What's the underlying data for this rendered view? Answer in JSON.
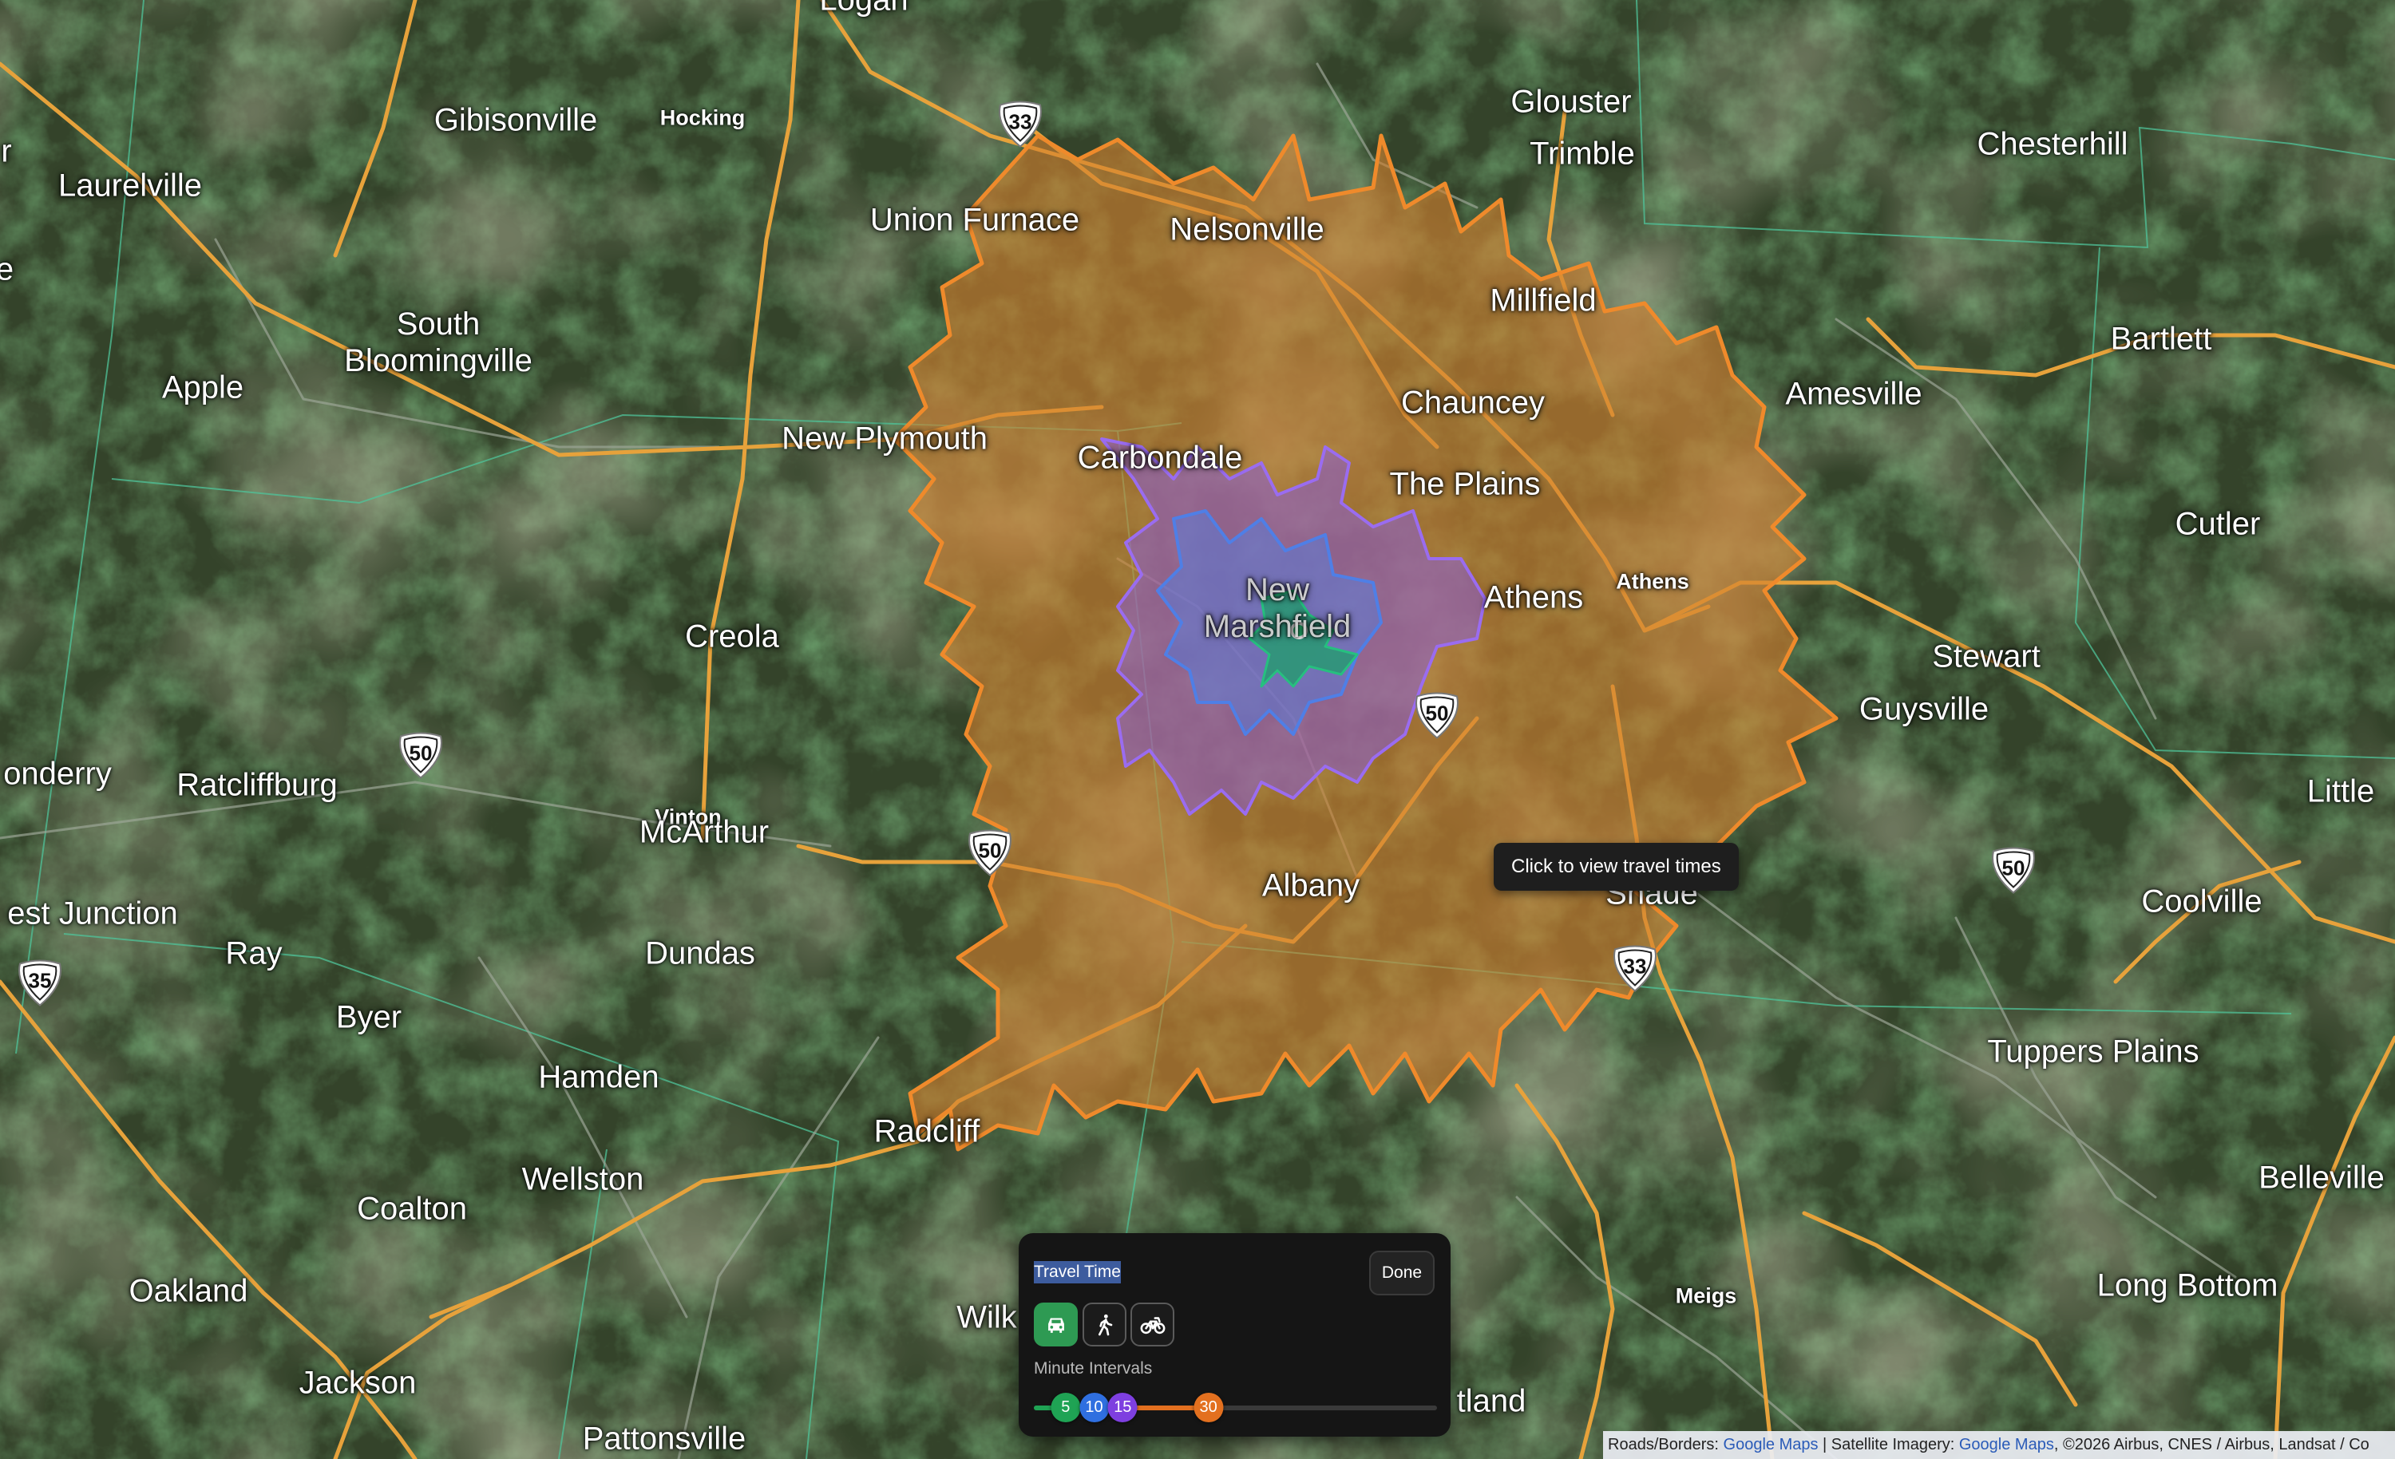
{
  "map": {
    "places": [
      {
        "id": "logan",
        "text": "Logan",
        "size": "big"
      },
      {
        "id": "gibisonville",
        "text": "Gibisonville",
        "size": "big"
      },
      {
        "id": "hocking",
        "text": "Hocking",
        "size": "small"
      },
      {
        "id": "laurelville",
        "text": "Laurelville",
        "size": "big"
      },
      {
        "id": "union-furnace",
        "text": "Union Furnace",
        "size": "big"
      },
      {
        "id": "nelsonville",
        "text": "Nelsonville",
        "size": "big"
      },
      {
        "id": "glouster",
        "text": "Glouster",
        "size": "big"
      },
      {
        "id": "trimble",
        "text": "Trimble",
        "size": "big"
      },
      {
        "id": "chesterhill",
        "text": "Chesterhill",
        "size": "big"
      },
      {
        "id": "millfield",
        "text": "Millfield",
        "size": "big"
      },
      {
        "id": "bartlett",
        "text": "Bartlett",
        "size": "big"
      },
      {
        "id": "apple",
        "text": "Apple",
        "size": "big"
      },
      {
        "id": "chauncey",
        "text": "Chauncey",
        "size": "big"
      },
      {
        "id": "amesville",
        "text": "Amesville",
        "size": "big"
      },
      {
        "id": "new-plymouth",
        "text": "New Plymouth",
        "size": "big"
      },
      {
        "id": "carbondale",
        "text": "Carbondale",
        "size": "big"
      },
      {
        "id": "the-plains",
        "text": "The Plains",
        "size": "big"
      },
      {
        "id": "cutler",
        "text": "Cutler",
        "size": "big"
      },
      {
        "id": "athens-county",
        "text": "Athens",
        "size": "small"
      },
      {
        "id": "athens",
        "text": "Athens",
        "size": "big"
      },
      {
        "id": "creola",
        "text": "Creola",
        "size": "big"
      },
      {
        "id": "stewart",
        "text": "Stewart",
        "size": "big"
      },
      {
        "id": "guysville",
        "text": "Guysville",
        "size": "big"
      },
      {
        "id": "londonderry",
        "text": "onderry",
        "size": "big"
      },
      {
        "id": "ratcliffburg",
        "text": "Ratcliffburg",
        "size": "big"
      },
      {
        "id": "vinton",
        "text": "Vinton",
        "size": "small"
      },
      {
        "id": "mcarthur",
        "text": "McArthur",
        "size": "big"
      },
      {
        "id": "little",
        "text": "Little",
        "size": "big"
      },
      {
        "id": "albany",
        "text": "Albany",
        "size": "big"
      },
      {
        "id": "coolville",
        "text": "Coolville",
        "size": "big"
      },
      {
        "id": "west-junction",
        "text": "est Junction",
        "size": "big"
      },
      {
        "id": "ray",
        "text": "Ray",
        "size": "big"
      },
      {
        "id": "dundas",
        "text": "Dundas",
        "size": "big"
      },
      {
        "id": "byer",
        "text": "Byer",
        "size": "big"
      },
      {
        "id": "shade",
        "text": "Shade",
        "size": "big"
      },
      {
        "id": "tuppers-plains",
        "text": "Tuppers Plains",
        "size": "big"
      },
      {
        "id": "hamden",
        "text": "Hamden",
        "size": "big"
      },
      {
        "id": "radcliff",
        "text": "Radcliff",
        "size": "big"
      },
      {
        "id": "wellston",
        "text": "Wellston",
        "size": "big"
      },
      {
        "id": "belleville",
        "text": "Belleville",
        "size": "big"
      },
      {
        "id": "coalton",
        "text": "Coalton",
        "size": "big"
      },
      {
        "id": "oakland",
        "text": "Oakland",
        "size": "big"
      },
      {
        "id": "long-bottom",
        "text": "Long Bottom",
        "size": "big"
      },
      {
        "id": "meigs",
        "text": "Meigs",
        "size": "small"
      },
      {
        "id": "wilkesville",
        "text": "Wilk",
        "size": "big"
      },
      {
        "id": "rutland",
        "text": "tland",
        "size": "big"
      },
      {
        "id": "jackson",
        "text": "Jackson",
        "size": "big"
      },
      {
        "id": "pattonsville",
        "text": "Pattonsville",
        "size": "big"
      },
      {
        "id": "edge-r",
        "text": "r",
        "size": "big"
      },
      {
        "id": "edge-e",
        "text": "e",
        "size": "big"
      }
    ],
    "south_bloomingville": [
      "South",
      "Bloomingville"
    ],
    "new_marshfield": [
      "New",
      "Marshfield"
    ],
    "shields": [
      {
        "id": "us-33-north",
        "route": "33",
        "type": "us"
      },
      {
        "id": "us-50-west",
        "route": "50",
        "type": "us"
      },
      {
        "id": "us-50-center",
        "route": "50",
        "type": "us"
      },
      {
        "id": "us-50-athens",
        "route": "50",
        "type": "us"
      },
      {
        "id": "us-50-east",
        "route": "50",
        "type": "us"
      },
      {
        "id": "us-33-south",
        "route": "33",
        "type": "us"
      },
      {
        "id": "us-35",
        "route": "35",
        "type": "us"
      }
    ]
  },
  "tooltip": {
    "text": "Click to view travel times"
  },
  "panel": {
    "title": "Travel Time",
    "done_label": "Done",
    "modes": [
      {
        "id": "drive",
        "icon": "car-icon",
        "active": true
      },
      {
        "id": "walk",
        "icon": "walking-person-icon",
        "active": false
      },
      {
        "id": "bike",
        "icon": "bicycle-icon",
        "active": false
      }
    ],
    "intervals_label": "Minute Intervals",
    "intervals": [
      {
        "minutes": "5",
        "color": "#1fa354"
      },
      {
        "minutes": "10",
        "color": "#2f6fe0"
      },
      {
        "minutes": "15",
        "color": "#7e3fe0"
      },
      {
        "minutes": "30",
        "color": "#e3701f"
      }
    ],
    "slider_max_minutes": 60
  },
  "attribution": {
    "roads_label": "Roads/Borders: ",
    "roads_source": "Google Maps",
    "imagery_label": " | Satellite Imagery: ",
    "imagery_source": "Google Maps",
    "credits": ", ©2026 Airbus, CNES / Airbus, Landsat / Co"
  },
  "colors": {
    "isochrone_30": "#d4812e",
    "isochrone_15": "#8a5cd8",
    "isochrone_10": "#4f7fe6",
    "isochrone_5": "#1e9f6a",
    "road": "#e7a23b",
    "terrain": "#2f3b22"
  }
}
